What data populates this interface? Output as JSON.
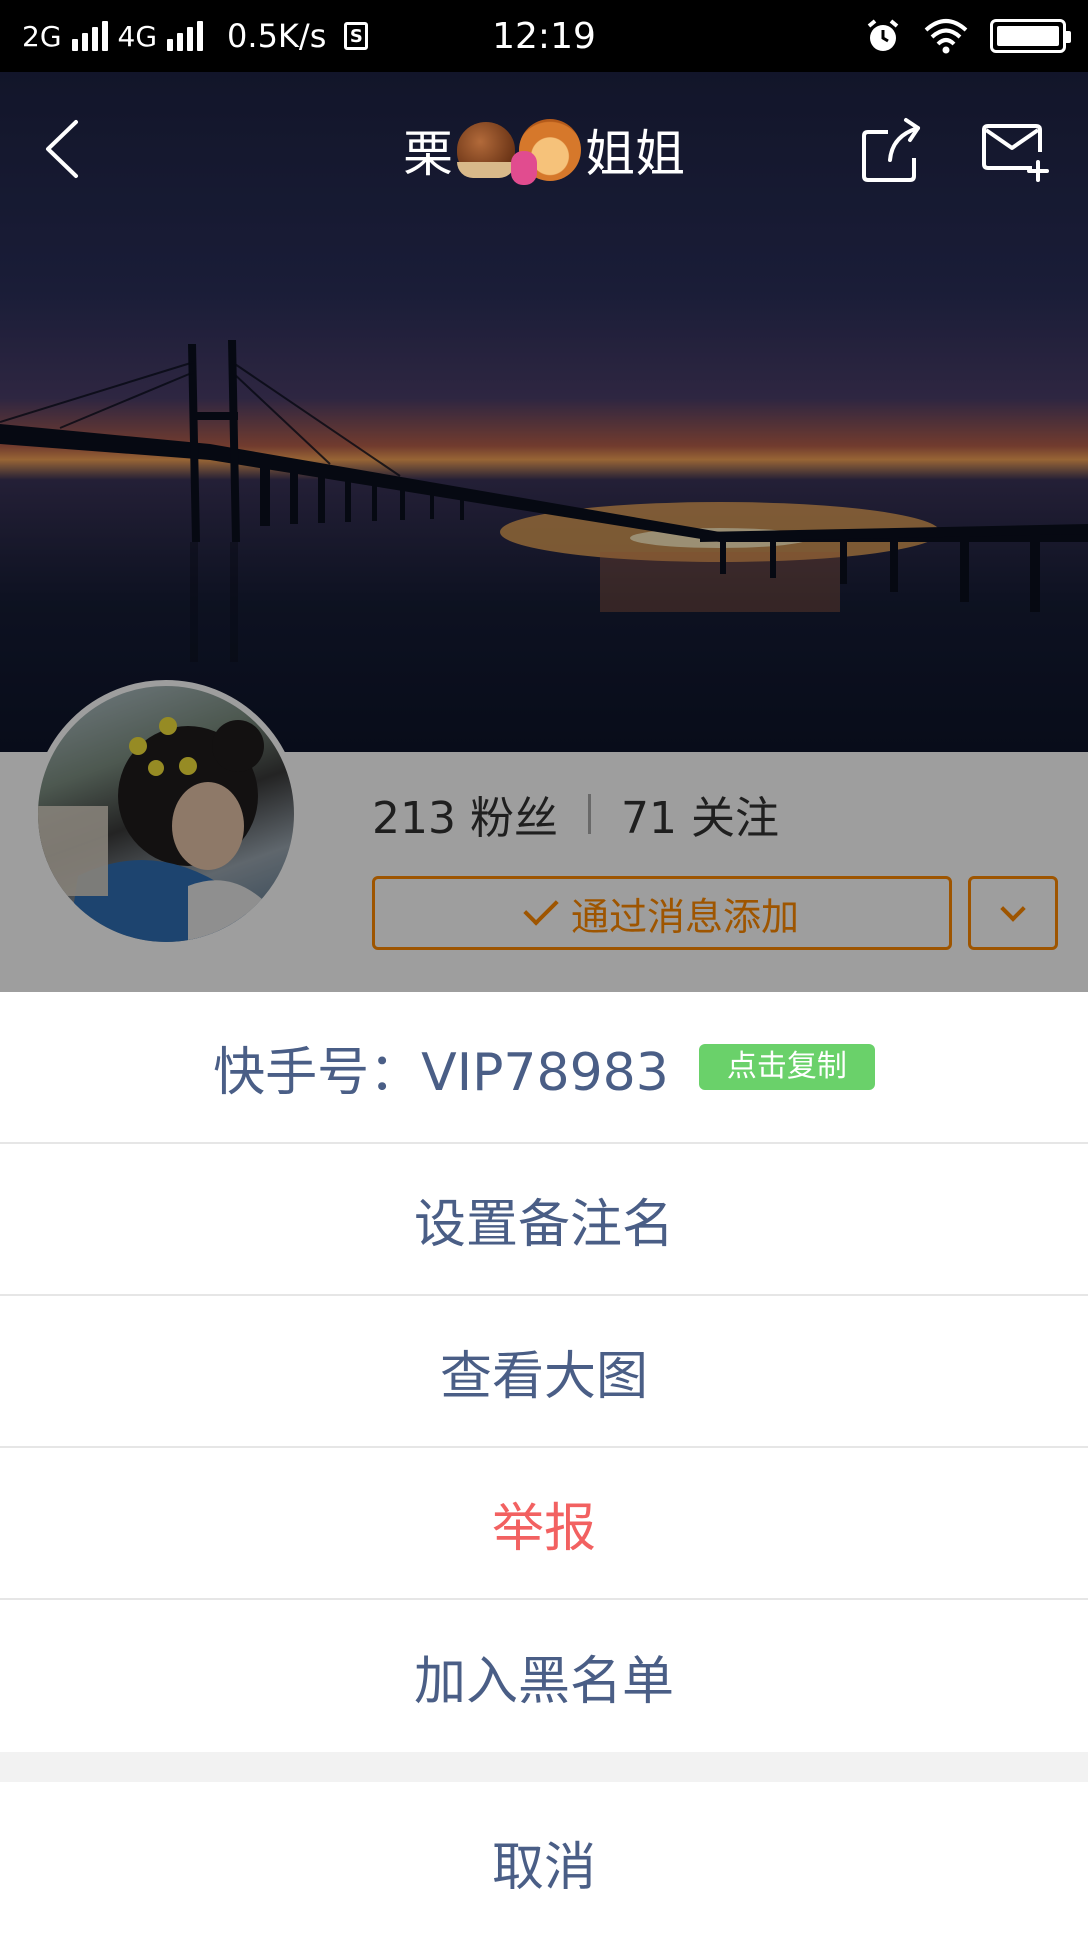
{
  "status_bar": {
    "net1": "2G",
    "net2": "4G",
    "speed": "0.5K/s",
    "sim_symbol": "S",
    "time": "12:19",
    "icons": [
      "alarm-icon",
      "wifi-icon",
      "battery-icon"
    ]
  },
  "header": {
    "title_prefix": "栗",
    "title_suffix": "姐姐",
    "title_emojis": [
      "chestnut-emoji",
      "woman-tipping-hand-emoji"
    ],
    "icons": [
      "back-icon",
      "share-icon",
      "mail-add-icon"
    ]
  },
  "profile": {
    "followers": "213 粉丝",
    "following": "71 关注",
    "add_button_label": "通过消息添加"
  },
  "action_sheet": {
    "kuaishou_id": "快手号：VIP78983",
    "copy_label": "点击复制",
    "items": [
      {
        "label": "设置备注名"
      },
      {
        "label": "查看大图"
      },
      {
        "label": "举报"
      },
      {
        "label": "加入黑名单"
      }
    ],
    "cancel_label": "取消"
  },
  "colors": {
    "accent_orange": "#ff8a00",
    "sheet_text": "#4a5e86",
    "danger_red": "#f26161",
    "copy_green": "#6ad16a"
  }
}
